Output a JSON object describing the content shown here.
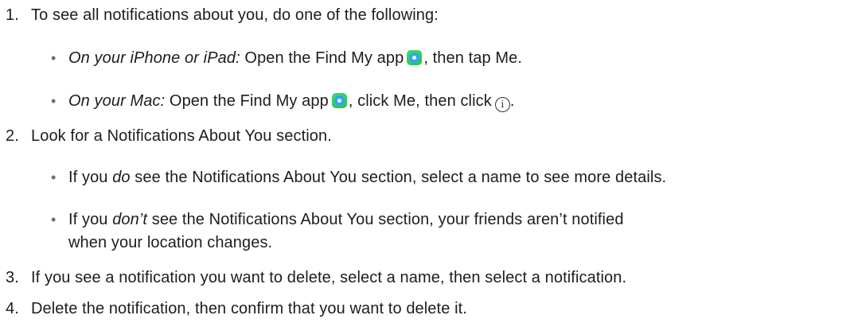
{
  "steps": [
    {
      "number": "1.",
      "text": "To see all notifications about you, do one of the following:",
      "items": [
        {
          "label": "On your iPhone or iPad:",
          "before_icon": " Open the Find My app",
          "after_icon": ", then tap Me."
        },
        {
          "label": "On your Mac:",
          "before_icon": " Open the Find My app",
          "after_icon": ", click Me, then click",
          "end": "."
        }
      ]
    },
    {
      "number": "2.",
      "text": "Look for a Notifications About You section.",
      "items": [
        {
          "pre": "If you ",
          "emph": "do",
          "post": " see the Notifications About You section, select a name to see more details."
        },
        {
          "pre": "If you ",
          "emph": "don’t",
          "post": " see the Notifications About You section, your friends aren’t notified",
          "continuation": "when your location changes."
        }
      ]
    },
    {
      "number": "3.",
      "text": "If you see a notification you want to delete, select a name, then select a notification."
    },
    {
      "number": "4.",
      "text": "Delete the notification, then confirm that you want to delete it."
    }
  ],
  "bullet_char": "•",
  "icons": {
    "app_icon": "find-my-app-icon",
    "info_icon": "info-circle-icon",
    "info_glyph": "i"
  }
}
